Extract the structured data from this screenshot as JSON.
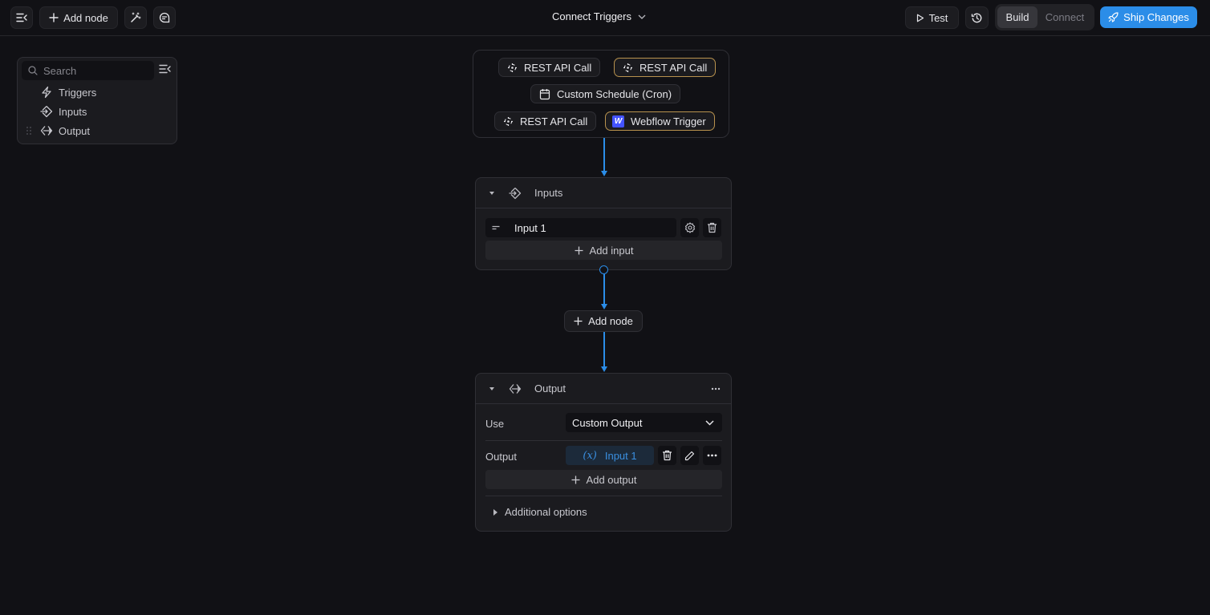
{
  "toolbar": {
    "add_node_label": "Add node",
    "title": "Connect Triggers",
    "test_label": "Test",
    "mode_tabs": [
      {
        "label": "Build",
        "active": true
      },
      {
        "label": "Connect",
        "active": false
      }
    ],
    "ship_label": "Ship Changes",
    "accent_color": "#2b8de8"
  },
  "outline": {
    "search_placeholder": "Search",
    "items": [
      {
        "label": "Triggers",
        "icon": "lightning-icon"
      },
      {
        "label": "Inputs",
        "icon": "enter-arrow-icon"
      },
      {
        "label": "Output",
        "icon": "exit-arrow-icon"
      }
    ]
  },
  "triggers": {
    "chips": [
      {
        "label": "REST API Call",
        "icon": "api-target-icon",
        "selected": false
      },
      {
        "label": "REST API Call",
        "icon": "api-target-icon",
        "selected": true
      },
      {
        "label": "Custom Schedule (Cron)",
        "icon": "calendar-icon",
        "selected": false
      },
      {
        "label": "REST API Call",
        "icon": "api-target-icon",
        "selected": false
      },
      {
        "label": "Webflow Trigger",
        "icon": "webflow-logo-icon",
        "selected": true
      }
    ],
    "webflow_glyph": "W",
    "selected_border_color": "#b8924e"
  },
  "inputs_node": {
    "title": "Inputs",
    "inputs": [
      {
        "name": "Input 1"
      }
    ],
    "add_label": "Add input"
  },
  "add_node_between_label": "Add node",
  "output_node": {
    "title": "Output",
    "use_label": "Use",
    "use_value": "Custom Output",
    "output_label": "Output",
    "output_var_glyph": "(x)",
    "output_var": "Input 1",
    "add_label": "Add output",
    "additional_label": "Additional options"
  }
}
